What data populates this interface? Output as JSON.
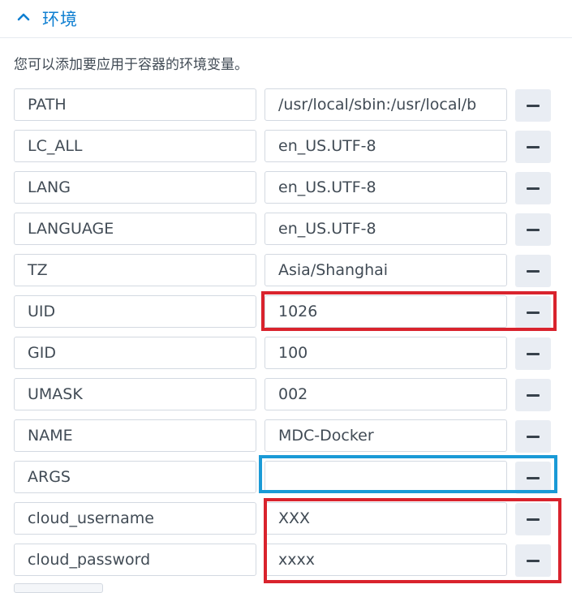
{
  "section": {
    "title": "环境",
    "collapse_icon": "chevron-up-icon"
  },
  "description": "您可以添加要应用于容器的环境变量。",
  "env_vars": [
    {
      "key": "PATH",
      "value": "/usr/local/sbin:/usr/local/b"
    },
    {
      "key": "LC_ALL",
      "value": "en_US.UTF-8"
    },
    {
      "key": "LANG",
      "value": "en_US.UTF-8"
    },
    {
      "key": "LANGUAGE",
      "value": "en_US.UTF-8"
    },
    {
      "key": "TZ",
      "value": "Asia/Shanghai"
    },
    {
      "key": "UID",
      "value": "1026"
    },
    {
      "key": "GID",
      "value": "100"
    },
    {
      "key": "UMASK",
      "value": "002"
    },
    {
      "key": "NAME",
      "value": "MDC-Docker"
    },
    {
      "key": "ARGS",
      "value": ""
    },
    {
      "key": "cloud_username",
      "value": "XXX"
    },
    {
      "key": "cloud_password",
      "value": "xxxx"
    }
  ],
  "remove_icon": "minus-icon",
  "colors": {
    "accent": "#0f7fd1",
    "highlight_red": "#d9232d",
    "highlight_blue": "#1a9ad6"
  }
}
